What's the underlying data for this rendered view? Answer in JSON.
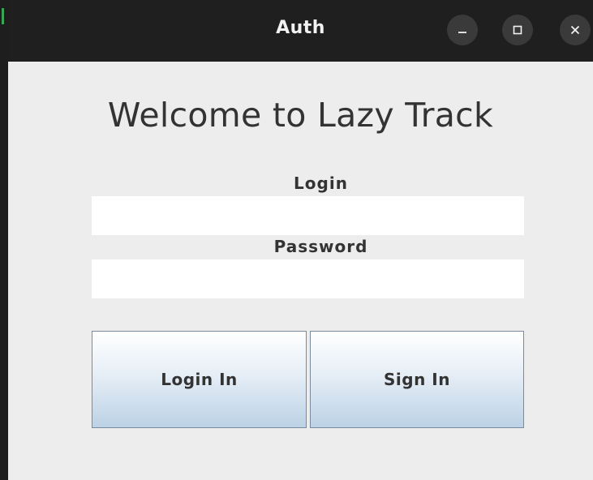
{
  "window": {
    "title": "Auth",
    "controls": {
      "minimize_icon": "minimize-icon",
      "maximize_icon": "maximize-icon",
      "close_icon": "close-icon"
    }
  },
  "main": {
    "heading": "Welcome to Lazy Track",
    "login": {
      "label": "Login",
      "value": "",
      "placeholder": ""
    },
    "password": {
      "label": "Password",
      "value": "",
      "placeholder": ""
    },
    "buttons": {
      "login_label": "Login In",
      "signin_label": "Sign In"
    }
  },
  "colors": {
    "titlebar": "#1f1f1f",
    "background": "#ededed",
    "button_gradient_bottom": "#bcd2e6",
    "text": "#333333"
  }
}
